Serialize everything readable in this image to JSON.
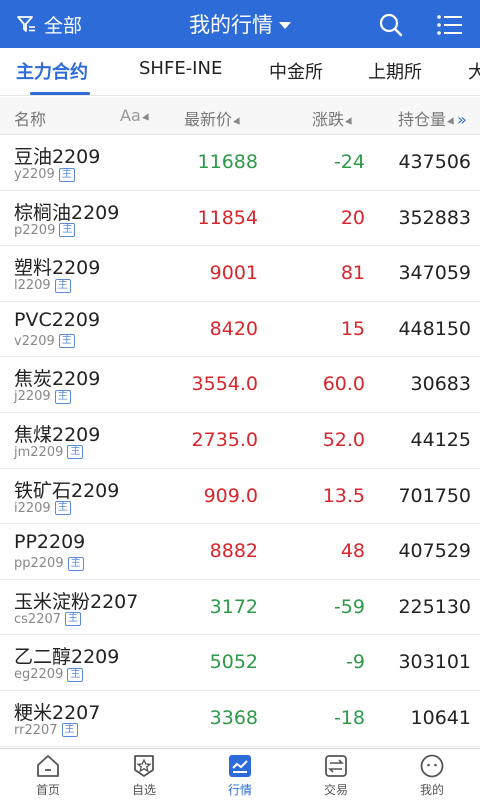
{
  "topbar": {
    "filter_label": "全部",
    "title": "我的行情"
  },
  "tabs": [
    {
      "label": "主力合约",
      "active": true
    },
    {
      "label": "SHFE-INE",
      "active": false
    },
    {
      "label": "中金所",
      "active": false
    },
    {
      "label": "上期所",
      "active": false
    },
    {
      "label": "大",
      "active": false
    }
  ],
  "table": {
    "headers": {
      "name": "名称",
      "font_toggle": "Aa",
      "last_price": "最新价",
      "change": "涨跌",
      "open_interest": "持仓量",
      "more": "»"
    },
    "main_tag": "主",
    "rows": [
      {
        "name": "豆油2209",
        "code": "y2209",
        "price": "11688",
        "change": "-24",
        "oi": "437506",
        "dir": "down"
      },
      {
        "name": "棕榈油2209",
        "code": "p2209",
        "price": "11854",
        "change": "20",
        "oi": "352883",
        "dir": "up"
      },
      {
        "name": "塑料2209",
        "code": "l2209",
        "price": "9001",
        "change": "81",
        "oi": "347059",
        "dir": "up"
      },
      {
        "name": "PVC2209",
        "code": "v2209",
        "price": "8420",
        "change": "15",
        "oi": "448150",
        "dir": "up"
      },
      {
        "name": "焦炭2209",
        "code": "j2209",
        "price": "3554.0",
        "change": "60.0",
        "oi": "30683",
        "dir": "up"
      },
      {
        "name": "焦煤2209",
        "code": "jm2209",
        "price": "2735.0",
        "change": "52.0",
        "oi": "44125",
        "dir": "up"
      },
      {
        "name": "铁矿石2209",
        "code": "i2209",
        "price": "909.0",
        "change": "13.5",
        "oi": "701750",
        "dir": "up"
      },
      {
        "name": "PP2209",
        "code": "pp2209",
        "price": "8882",
        "change": "48",
        "oi": "407529",
        "dir": "up"
      },
      {
        "name": "玉米淀粉2207",
        "code": "cs2207",
        "price": "3172",
        "change": "-59",
        "oi": "225130",
        "dir": "down"
      },
      {
        "name": "乙二醇2209",
        "code": "eg2209",
        "price": "5052",
        "change": "-9",
        "oi": "303101",
        "dir": "down"
      },
      {
        "name": "粳米2207",
        "code": "rr2207",
        "price": "3368",
        "change": "-18",
        "oi": "10641",
        "dir": "down"
      }
    ]
  },
  "bottom_nav": [
    {
      "label": "首页",
      "icon": "home-icon",
      "active": false
    },
    {
      "label": "自选",
      "icon": "star-shield-icon",
      "active": false
    },
    {
      "label": "行情",
      "icon": "chart-icon",
      "active": true
    },
    {
      "label": "交易",
      "icon": "exchange-icon",
      "active": false
    },
    {
      "label": "我的",
      "icon": "profile-icon",
      "active": false
    }
  ],
  "colors": {
    "brand": "#2d6cd8",
    "up": "#d7262c",
    "down": "#2e9a49"
  }
}
